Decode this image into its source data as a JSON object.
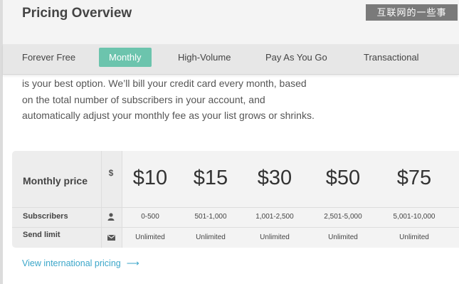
{
  "header": {
    "title": "Pricing Overview",
    "watermark": "互联网的一些事"
  },
  "tabs": [
    {
      "label": "Forever Free"
    },
    {
      "label": "Monthly"
    },
    {
      "label": "High-Volume"
    },
    {
      "label": "Pay As You Go"
    },
    {
      "label": "Transactional"
    }
  ],
  "active_tab": "Monthly",
  "intro_lines": [
    "is your best option. We’ll bill your credit card every month, based",
    "on the total number of subscribers in your account, and",
    "automatically adjust your monthly fee as your list grows or shrinks."
  ],
  "table": {
    "rows": {
      "price": {
        "label": "Monthly price",
        "icon": "$"
      },
      "subscribers": {
        "label": "Subscribers",
        "icon": "user-icon"
      },
      "send_limit": {
        "label": "Send limit",
        "icon": "envelope-icon"
      }
    },
    "plans": [
      {
        "price": "$10",
        "subscribers": "0-500",
        "send_limit": "Unlimited"
      },
      {
        "price": "$15",
        "subscribers": "501-1,000",
        "send_limit": "Unlimited"
      },
      {
        "price": "$30",
        "subscribers": "1,001-2,500",
        "send_limit": "Unlimited"
      },
      {
        "price": "$50",
        "subscribers": "2,501-5,000",
        "send_limit": "Unlimited"
      },
      {
        "price": "$75",
        "subscribers": "5,001-10,000",
        "send_limit": "Unlimited"
      }
    ]
  },
  "link": {
    "label": "View international pricing",
    "arrow": "⟶"
  },
  "colors": {
    "accent": "#6cc4ad",
    "link": "#3aa6c9"
  }
}
